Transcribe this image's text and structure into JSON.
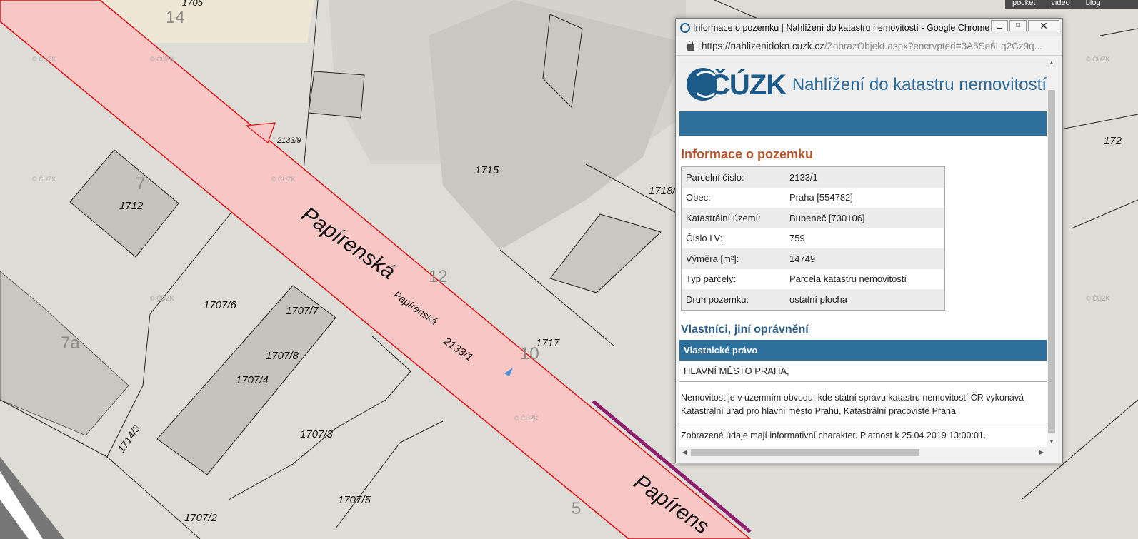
{
  "map": {
    "watermark": "© ČÚZK",
    "street_labels": [
      "Papírenská",
      "Papírenská",
      "Papírens"
    ],
    "parcel_labels": [
      "2133/9",
      "1715",
      "1712",
      "1718/",
      "1707/6",
      "1707/7",
      "1707/8",
      "1707/4",
      "1707/3",
      "1707/5",
      "1707/2",
      "1714/3",
      "2133/1",
      "1717",
      "172",
      "1705"
    ],
    "house_numbers": [
      "14",
      "7",
      "12",
      "7a",
      "10",
      "5"
    ]
  },
  "top_links": [
    "pocket",
    "video",
    "blog"
  ],
  "window": {
    "title": "Informace o pozemku | Nahlížení do katastru nemovitostí - Google Chrome",
    "url_host": "https://nahlizenidokn.cuzk.cz",
    "url_rest": "/ZobrazObjekt.aspx?encrypted=3A5Se6Lq2Cz9q..."
  },
  "page": {
    "logo_text": "ČÚZK",
    "portal_title": "Nahlížení do katastru nemovitostí",
    "section_title": "Informace o pozemku",
    "rows": [
      {
        "label": "Parcelní číslo:",
        "value": "2133/1"
      },
      {
        "label": "Obec:",
        "value": "Praha [554782]"
      },
      {
        "label": "Katastrální území:",
        "value": "Bubeneč [730106]"
      },
      {
        "label": "Číslo LV:",
        "value": "759"
      },
      {
        "label": "Výměra [m²]:",
        "value": "14749"
      },
      {
        "label": "Typ parcely:",
        "value": "Parcela katastru nemovitostí"
      },
      {
        "label": "Druh pozemku:",
        "value": "ostatní plocha"
      }
    ],
    "owners_title": "Vlastníci, jiní oprávnění",
    "owners_header": "Vlastnické právo",
    "owner": "HLAVNÍ MĚSTO PRAHA,",
    "note_line1": "Nemovitost je v územním obvodu, kde státní správu katastru nemovitostí ČR vykonává",
    "note_line2": "Katastrální úřad pro hlavní město Prahu, Katastrální pracoviště Praha",
    "footer": "Zobrazené údaje mají informativní charakter. Platnost k 25.04.2019 13:00:01."
  },
  "colors": {
    "road_fill": "#f9c6c6",
    "road_edge": "#e01010",
    "header_blue": "#2f6f9c",
    "section_orange": "#b5532b"
  }
}
